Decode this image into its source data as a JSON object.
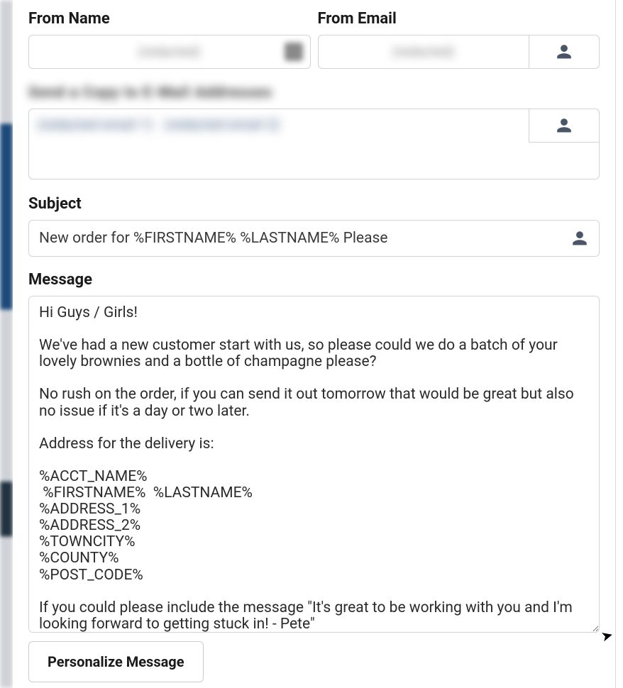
{
  "labels": {
    "from_name": "From Name",
    "from_email": "From Email",
    "send_to": "Send a Copy to E-Mail Addresses",
    "subject": "Subject",
    "message": "Message"
  },
  "from_name": {
    "value": "(redacted)"
  },
  "from_email": {
    "value": "(redacted)"
  },
  "to_recipients_blurred": {
    "chip1": "(redacted email 1)",
    "chip2": "(redacted email 2)"
  },
  "subject": {
    "value": "New order for %FIRSTNAME% %LASTNAME% Please"
  },
  "message": {
    "value": "Hi Guys / Girls!\n\nWe've had a new customer start with us, so please could we do a batch of your lovely brownies and a bottle of champagne please?\n\nNo rush on the order, if you can send it out tomorrow that would be great but also no issue if it's a day or two later.\n\nAddress for the delivery is:\n\n%ACCT_NAME%\n %FIRSTNAME%  %LASTNAME%\n%ADDRESS_1%\n%ADDRESS_2%\n%TOWNCITY%\n%COUNTY%\n%POST_CODE%\n\nIf you could please include the message \"It's great to be working with you and I'm looking forward to getting stuck in! - Pete\""
  },
  "buttons": {
    "personalize": "Personalize Message"
  },
  "icons": {
    "person": "person-icon"
  }
}
